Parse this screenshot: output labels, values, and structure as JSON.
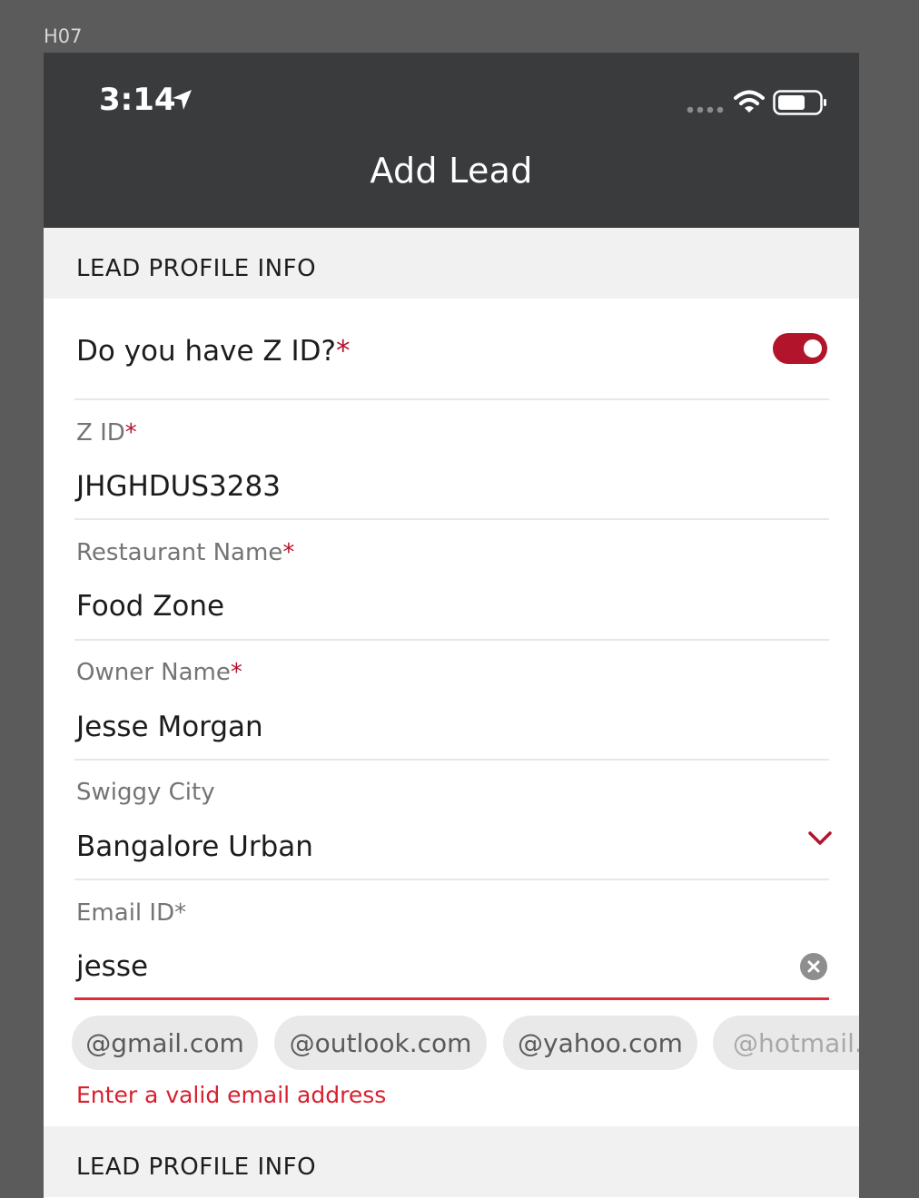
{
  "artboard": {
    "label": "H07"
  },
  "status_bar": {
    "time": "3:14"
  },
  "navbar": {
    "title": "Add Lead"
  },
  "sections": [
    {
      "title": "LEAD PROFILE INFO"
    },
    {
      "title": "LEAD PROFILE INFO"
    }
  ],
  "form": {
    "has_zid": {
      "label": "Do you have Z ID?",
      "required_mark": "*",
      "enabled": true
    },
    "zid": {
      "label": "Z ID",
      "required_mark": "*",
      "value": "JHGHDUS3283"
    },
    "restaurant_name": {
      "label": "Restaurant Name",
      "required_mark": "*",
      "value": "Food Zone"
    },
    "owner_name": {
      "label": "Owner Name",
      "required_mark": "*",
      "value": "Jesse Morgan"
    },
    "swiggy_city": {
      "label": "Swiggy City",
      "value": "Bangalore Urban"
    },
    "email": {
      "label": "Email ID*",
      "value": "jesse",
      "error": "Enter a valid email address"
    }
  },
  "email_suggestions": [
    "@gmail.com",
    "@outlook.com",
    "@yahoo.com",
    "@hotmail.com"
  ],
  "colors": {
    "accent": "#b2142c",
    "error": "#d8202e",
    "navbar": "#3a3b3d",
    "section_bg": "#f1f1f1",
    "chip_bg": "#e9e9e9"
  },
  "icons": [
    "location-arrow-icon",
    "signal-icon",
    "wifi-icon",
    "battery-icon",
    "chevron-down-icon",
    "clear-icon"
  ]
}
